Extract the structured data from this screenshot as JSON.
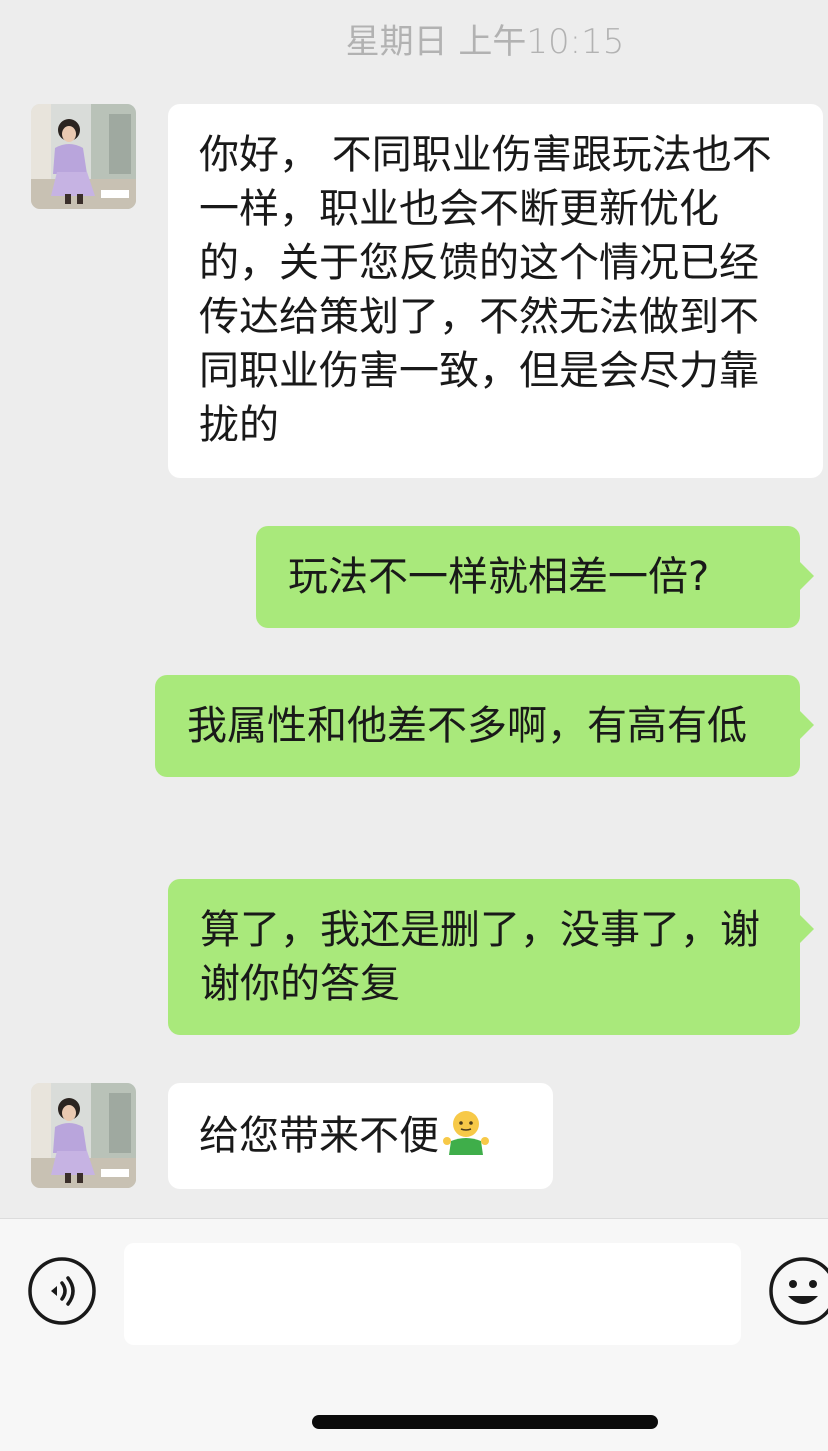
{
  "chat": {
    "timestamp": "星期日 上午10:15",
    "messages": [
      {
        "direction": "incoming",
        "text": "你好， 不同职业伤害跟玩法也不一样，职业也会不断更新优化的，关于您反馈的这个情况已经传达给策划了，不然无法做到不同职业伤害一致，但是会尽力靠拢的"
      },
      {
        "direction": "outgoing",
        "text": "玩法不一样就相差一倍?"
      },
      {
        "direction": "outgoing",
        "text": "我属性和他差不多啊，有高有低"
      },
      {
        "direction": "outgoing",
        "text": "算了，我还是删了，没事了，谢谢你的答复"
      },
      {
        "direction": "incoming",
        "text": "给您带来不便",
        "trailing_emoji": "shrug-figure-emoji"
      }
    ]
  },
  "input_bar": {
    "voice_icon": "voice-wave-icon",
    "input_value": "",
    "emoji_icon": "smiley-face-icon"
  },
  "colors": {
    "background": "#ededed",
    "outgoing_bubble": "#a9e97b",
    "incoming_bubble": "#ffffff",
    "timestamp_text": "#b2b2b2"
  }
}
